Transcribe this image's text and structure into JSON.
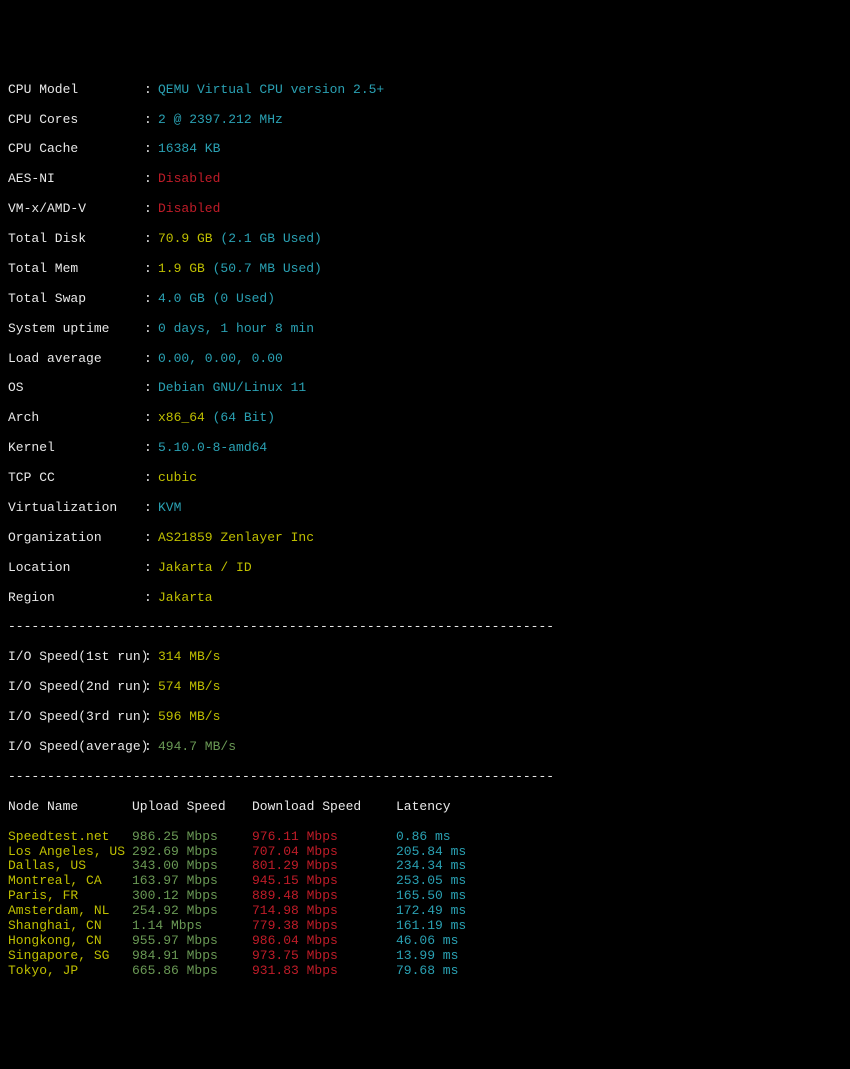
{
  "sys": {
    "cpu_model": {
      "label": "CPU Model",
      "value": "QEMU Virtual CPU version 2.5+"
    },
    "cpu_cores": {
      "label": "CPU Cores",
      "value": "2 @ 2397.212 MHz"
    },
    "cpu_cache": {
      "label": "CPU Cache",
      "value": "16384 KB"
    },
    "aes_ni": {
      "label": "AES-NI",
      "value": "Disabled"
    },
    "vmx": {
      "label": "VM-x/AMD-V",
      "value": "Disabled"
    },
    "total_disk": {
      "label": "Total Disk",
      "value": "70.9 GB",
      "note": "(2.1 GB Used)"
    },
    "total_mem": {
      "label": "Total Mem",
      "value": "1.9 GB",
      "note": "(50.7 MB Used)"
    },
    "total_swap": {
      "label": "Total Swap",
      "value": "4.0 GB",
      "note": "(0 Used)"
    },
    "uptime": {
      "label": "System uptime",
      "value": "0 days, 1 hour 8 min"
    },
    "loadavg": {
      "label": "Load average",
      "value": "0.00, 0.00, 0.00"
    },
    "os": {
      "label": "OS",
      "value": "Debian GNU/Linux 11"
    },
    "arch": {
      "label": "Arch",
      "value": "x86_64",
      "note": "(64 Bit)"
    },
    "kernel": {
      "label": "Kernel",
      "value": "5.10.0-8-amd64"
    },
    "tcp_cc": {
      "label": "TCP CC",
      "value": "cubic"
    },
    "virt": {
      "label": "Virtualization",
      "value": "KVM"
    },
    "org": {
      "label": "Organization",
      "value": "AS21859 Zenlayer Inc"
    },
    "loc": {
      "label": "Location",
      "value": "Jakarta / ID"
    },
    "region": {
      "label": "Region",
      "value": "Jakarta"
    }
  },
  "divider": "----------------------------------------------------------------------",
  "io": {
    "r1": {
      "label": "I/O Speed(1st run)",
      "value": "314 MB/s"
    },
    "r2": {
      "label": "I/O Speed(2nd run)",
      "value": "574 MB/s"
    },
    "r3": {
      "label": "I/O Speed(3rd run)",
      "value": "596 MB/s"
    },
    "avg": {
      "label": "I/O Speed(average)",
      "value": "494.7 MB/s"
    }
  },
  "table": {
    "headers": {
      "node": "Node Name",
      "up": "Upload Speed",
      "down": "Download Speed",
      "lat": "Latency"
    },
    "rows": [
      {
        "node": "Speedtest.net",
        "up": "986.25 Mbps",
        "down": "976.11 Mbps",
        "lat": "0.86 ms"
      },
      {
        "node": "Los Angeles, US",
        "up": "292.69 Mbps",
        "down": "707.04 Mbps",
        "lat": "205.84 ms"
      },
      {
        "node": "Dallas, US",
        "up": "343.00 Mbps",
        "down": "801.29 Mbps",
        "lat": "234.34 ms"
      },
      {
        "node": "Montreal, CA",
        "up": "163.97 Mbps",
        "down": "945.15 Mbps",
        "lat": "253.05 ms"
      },
      {
        "node": "Paris, FR",
        "up": "300.12 Mbps",
        "down": "889.48 Mbps",
        "lat": "165.50 ms"
      },
      {
        "node": "Amsterdam, NL",
        "up": "254.92 Mbps",
        "down": "714.98 Mbps",
        "lat": "172.49 ms"
      },
      {
        "node": "Shanghai, CN",
        "up": "1.14 Mbps",
        "down": "779.38 Mbps",
        "lat": "161.19 ms"
      },
      {
        "node": "Hongkong, CN",
        "up": "955.97 Mbps",
        "down": "986.04 Mbps",
        "lat": "46.06 ms"
      },
      {
        "node": "Singapore, SG",
        "up": "984.91 Mbps",
        "down": "973.75 Mbps",
        "lat": "13.99 ms"
      },
      {
        "node": "Tokyo, JP",
        "up": "665.86 Mbps",
        "down": "931.83 Mbps",
        "lat": "79.68 ms"
      }
    ]
  }
}
